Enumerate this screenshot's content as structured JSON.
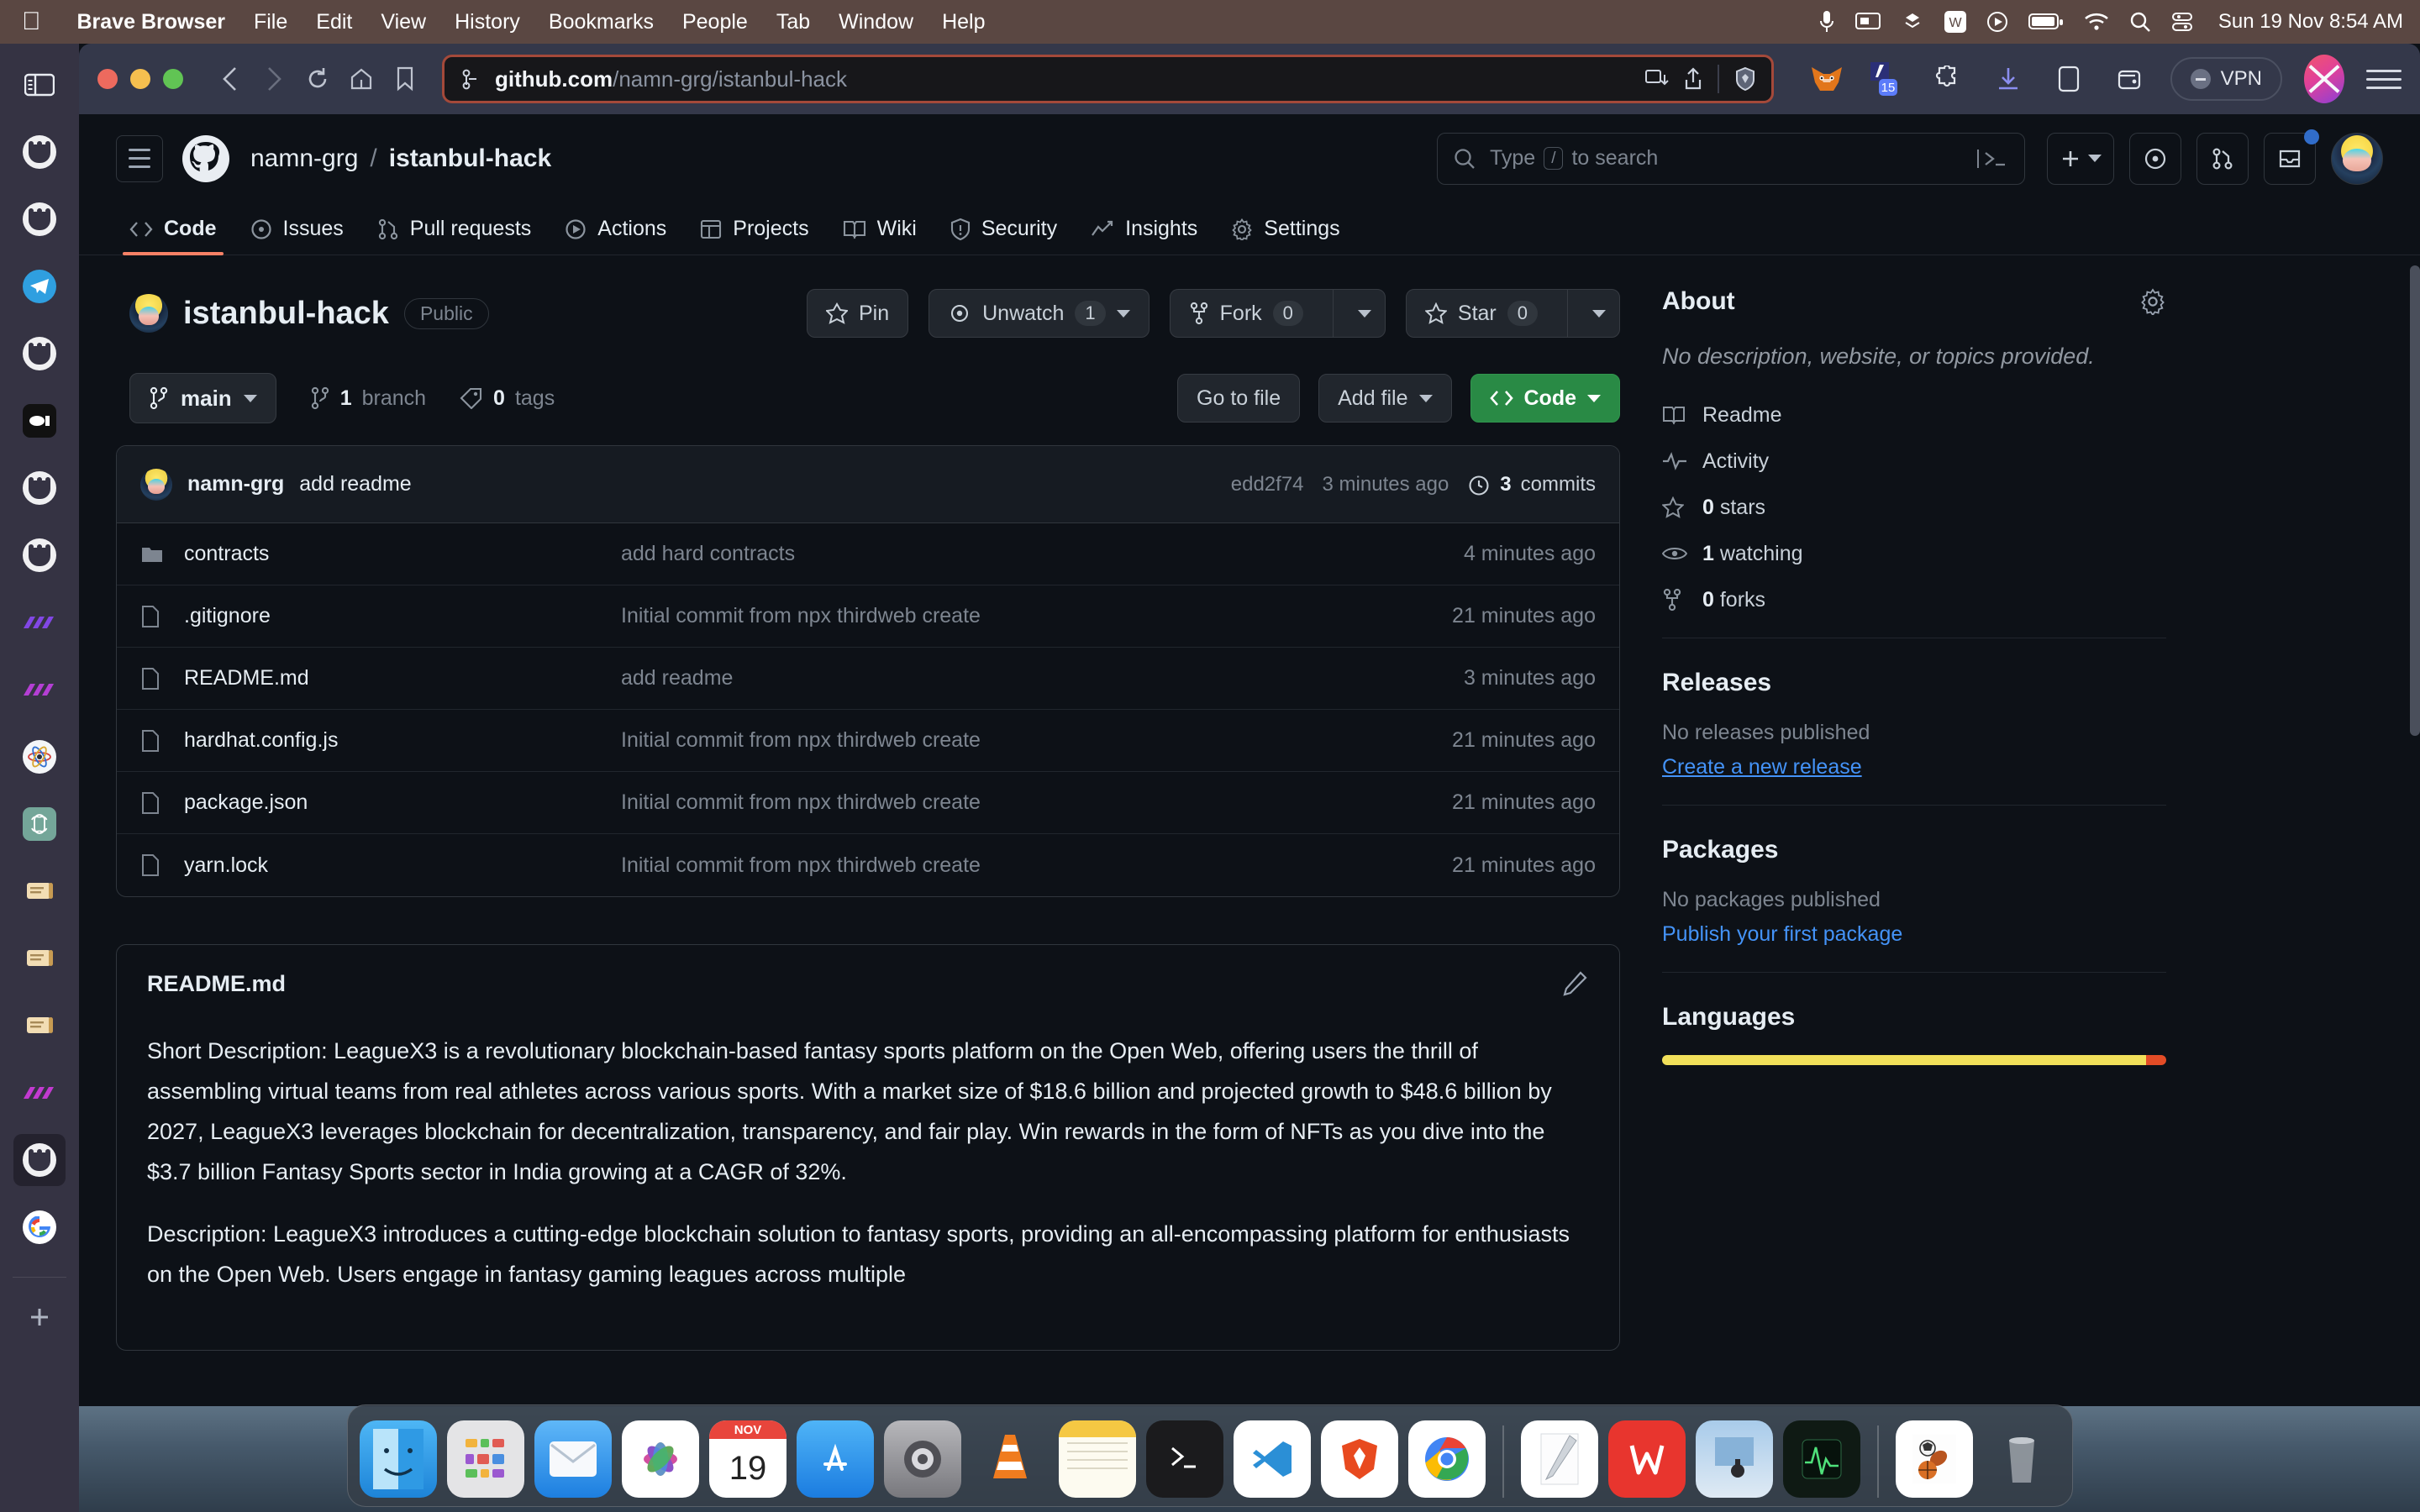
{
  "menubar": {
    "apple_icon": "apple-logo-icon",
    "app": "Brave Browser",
    "items": [
      "File",
      "Edit",
      "View",
      "History",
      "Bookmarks",
      "People",
      "Tab",
      "Window",
      "Help"
    ],
    "status_icons": [
      "microphone-icon",
      "screen-mirroring-icon",
      "dropbox-icon",
      "wps-icon",
      "vlc-icon",
      "battery-icon",
      "wifi-icon",
      "spotlight-search-icon",
      "control-center-icon"
    ],
    "clock": "Sun 19 Nov  8:54 AM"
  },
  "browser": {
    "traffic_lights": [
      "close-button",
      "minimize-button",
      "maximize-button"
    ],
    "nav": {
      "back": "back-button",
      "forward": "forward-button",
      "reload": "reload-button",
      "home": "home-button",
      "bookmark": "bookmark-button"
    },
    "url": {
      "protocol_icon": "site-settings-icon",
      "domain": "github.com",
      "path": "/namn-grg/istanbul-hack"
    },
    "url_right_icons": [
      "split-view-icon",
      "share-icon",
      "brave-shields-icon"
    ],
    "extensions": [
      "metamask-icon",
      "extension-badge-15-icon",
      "puzzle-extension-icon",
      "downloads-icon",
      "sidebar-panel-icon",
      "wallet-icon"
    ],
    "vpn_label": "VPN",
    "profile_icon": "brave-profile-avatar",
    "menu_icon": "browser-menu-icon"
  },
  "activity_bar": {
    "icons": [
      "sidebar-toggle-icon",
      "github-icon",
      "github-icon",
      "telegram-icon",
      "github-icon",
      "loom-icon",
      "github-icon",
      "github-icon",
      "polygon-icon",
      "polygon-icon",
      "atom-icon",
      "openai-icon",
      "scroll-icon",
      "scroll-icon",
      "scroll-icon",
      "polygon-icon",
      "github-icon",
      "google-icon"
    ],
    "add_label": "add-tab-icon"
  },
  "github": {
    "header": {
      "menu_icon": "hamburger-menu-icon",
      "logo_icon": "github-mark-icon",
      "owner": "namn-grg",
      "separator": "/",
      "repo": "istanbul-hack",
      "search_placeholder": "Type",
      "search_key": "/",
      "search_suffix": "to search",
      "command_palette_icon": "command-palette-icon",
      "actions": [
        "create-new-icon",
        "issues-icon",
        "pull-requests-icon",
        "notifications-inbox-icon",
        "user-avatar"
      ]
    },
    "nav_tabs": [
      {
        "label": "Code",
        "icon": "code-icon",
        "active": true
      },
      {
        "label": "Issues",
        "icon": "issue-opened-icon",
        "active": false
      },
      {
        "label": "Pull requests",
        "icon": "git-pull-request-icon",
        "active": false
      },
      {
        "label": "Actions",
        "icon": "play-icon",
        "active": false
      },
      {
        "label": "Projects",
        "icon": "table-icon",
        "active": false
      },
      {
        "label": "Wiki",
        "icon": "book-icon",
        "active": false
      },
      {
        "label": "Security",
        "icon": "shield-icon",
        "active": false
      },
      {
        "label": "Insights",
        "icon": "graph-icon",
        "active": false
      },
      {
        "label": "Settings",
        "icon": "gear-icon",
        "active": false
      }
    ],
    "repo": {
      "name": "istanbul-hack",
      "visibility": "Public",
      "pin_label": "Pin",
      "watch_label": "Unwatch",
      "watch_count": "1",
      "fork_label": "Fork",
      "fork_count": "0",
      "star_label": "Star",
      "star_count": "0"
    },
    "branch_bar": {
      "branch": "main",
      "branch_count": "1",
      "branch_word": "branch",
      "tag_count": "0",
      "tag_word": "tags",
      "go_to_file": "Go to file",
      "add_file": "Add file",
      "code": "Code"
    },
    "commit": {
      "user": "namn-grg",
      "message": "add readme",
      "sha": "edd2f74",
      "age": "3 minutes ago",
      "commits_count": "3",
      "commits_label": "commits"
    },
    "files": [
      {
        "icon": "folder-icon",
        "name": "contracts",
        "message": "add hard contracts",
        "age": "4 minutes ago"
      },
      {
        "icon": "file-icon",
        "name": ".gitignore",
        "message": "Initial commit from npx thirdweb create",
        "age": "21 minutes ago"
      },
      {
        "icon": "file-icon",
        "name": "README.md",
        "message": "add readme",
        "age": "3 minutes ago"
      },
      {
        "icon": "file-icon",
        "name": "hardhat.config.js",
        "message": "Initial commit from npx thirdweb create",
        "age": "21 minutes ago"
      },
      {
        "icon": "file-icon",
        "name": "package.json",
        "message": "Initial commit from npx thirdweb create",
        "age": "21 minutes ago"
      },
      {
        "icon": "file-icon",
        "name": "yarn.lock",
        "message": "Initial commit from npx thirdweb create",
        "age": "21 minutes ago"
      }
    ],
    "readme": {
      "title": "README.md",
      "edit_icon": "pencil-icon",
      "paragraphs": [
        "Short Description: LeagueX3 is a revolutionary blockchain-based fantasy sports platform on the Open Web, offering users the thrill of assembling virtual teams from real athletes across various sports. With a market size of $18.6 billion and projected growth to $48.6 billion by 2027, LeagueX3 leverages blockchain for decentralization, transparency, and fair play. Win rewards in the form of NFTs as you dive into the $3.7 billion Fantasy Sports sector in India growing at a CAGR of 32%.",
        "Description: LeagueX3 introduces a cutting-edge blockchain solution to fantasy sports, providing an all-encompassing platform for enthusiasts on the Open Web. Users engage in fantasy gaming leagues across multiple"
      ]
    },
    "sidebar": {
      "about_title": "About",
      "about_gear": "gear-icon",
      "about_description": "No description, website, or topics provided.",
      "links": [
        {
          "icon": "book-icon",
          "label": "Readme"
        },
        {
          "icon": "pulse-icon",
          "label": "Activity"
        },
        {
          "icon": "star-icon",
          "label": "0 stars",
          "bold": "0",
          "rest": " stars"
        },
        {
          "icon": "eye-icon",
          "label": "1 watching",
          "bold": "1",
          "rest": " watching"
        },
        {
          "icon": "fork-icon",
          "label": "0 forks",
          "bold": "0",
          "rest": " forks"
        }
      ],
      "releases_title": "Releases",
      "releases_empty": "No releases published",
      "releases_link": "Create a new release",
      "packages_title": "Packages",
      "packages_empty": "No packages published",
      "packages_link": "Publish your first package",
      "languages_title": "Languages"
    }
  },
  "dock": {
    "items": [
      {
        "name": "finder",
        "color": "#3b9ae2"
      },
      {
        "name": "launchpad",
        "color": "#d8d8d8"
      },
      {
        "name": "mail",
        "color": "#2a7fe8"
      },
      {
        "name": "photos",
        "color": "#ffffff"
      },
      {
        "name": "calendar",
        "color": "#ffffff",
        "badge": "NOV",
        "day": "19"
      },
      {
        "name": "app-store",
        "color": "#2b8cf0"
      },
      {
        "name": "system-settings",
        "color": "#8a8a8e"
      },
      {
        "name": "vlc",
        "color": "#1d1d1f"
      },
      {
        "name": "notes",
        "color": "#fcf0b0"
      },
      {
        "name": "terminal",
        "color": "#1b1b1d"
      },
      {
        "name": "vs-code",
        "color": "#ffffff"
      },
      {
        "name": "brave",
        "color": "#ffffff"
      },
      {
        "name": "chrome",
        "color": "#ffffff"
      },
      {
        "name": "preview",
        "color": "#ffffff"
      },
      {
        "name": "wps-office",
        "color": "#e8352e"
      },
      {
        "name": "screenshot",
        "color": "#b8cfe4"
      },
      {
        "name": "activity-monitor",
        "color": "#0f1a14"
      },
      {
        "name": "sports-folder",
        "color": "#ffffff"
      },
      {
        "name": "trash",
        "color": "#8e9196"
      }
    ]
  }
}
